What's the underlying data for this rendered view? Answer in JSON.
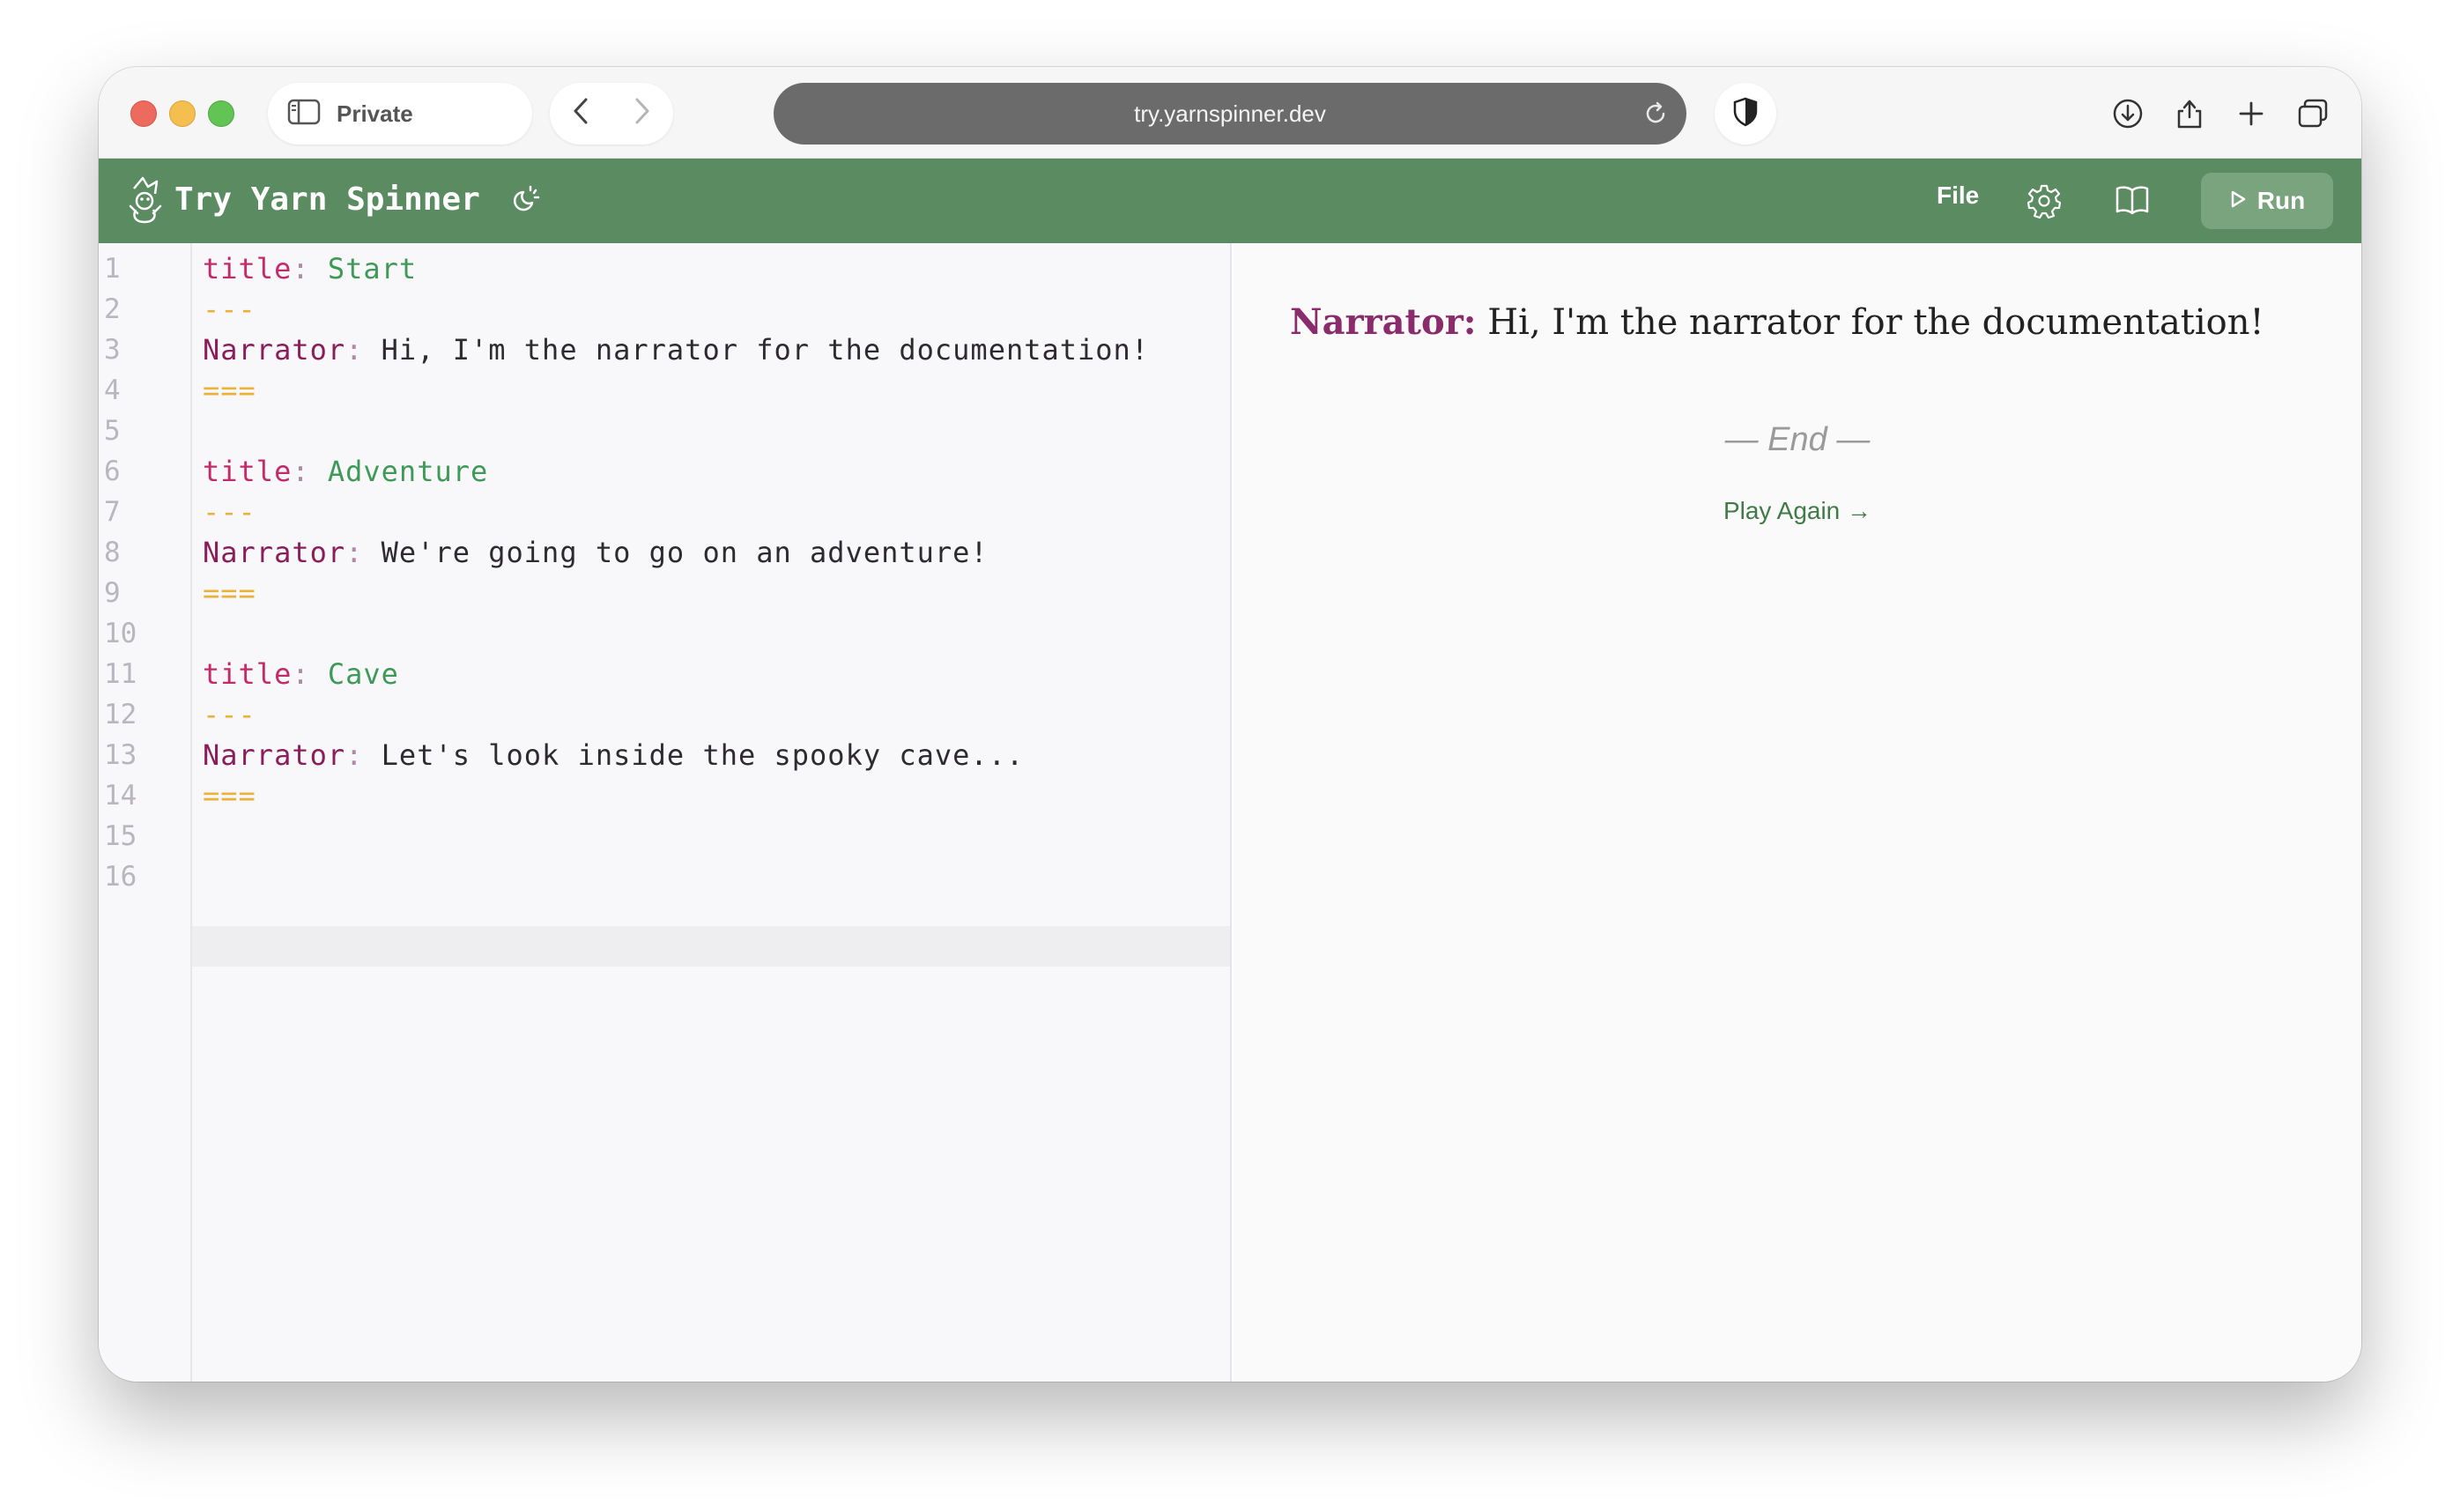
{
  "browser": {
    "private_label": "Private",
    "url": "try.yarnspinner.dev",
    "icons": [
      "sidebar-icon",
      "back-icon",
      "forward-icon",
      "reload-icon",
      "shield-icon",
      "download-icon",
      "share-icon",
      "new-tab-icon",
      "tabs-overview-icon"
    ]
  },
  "app": {
    "title": "Try Yarn Spinner",
    "file_label": "File",
    "run_label": "Run",
    "accent_color": "#5b8b61"
  },
  "editor": {
    "line_numbers": [
      "1",
      "2",
      "3",
      "4",
      "5",
      "6",
      "7",
      "8",
      "9",
      "10",
      "11",
      "12",
      "13",
      "14",
      "15",
      "16"
    ],
    "lines": [
      {
        "key": "title",
        "colon": ":",
        "value": " Start"
      },
      {
        "dash": "---"
      },
      {
        "char": "Narrator",
        "colon": ":",
        "text": " Hi, I'm the narrator for the documentation!"
      },
      {
        "dash": "==="
      },
      {},
      {
        "key": "title",
        "colon": ":",
        "value": " Adventure"
      },
      {
        "dash": "---"
      },
      {
        "char": "Narrator",
        "colon": ":",
        "text": " We're going to go on an adventure!"
      },
      {
        "dash": "==="
      },
      {},
      {
        "key": "title",
        "colon": ":",
        "value": " Cave"
      },
      {
        "dash": "---"
      },
      {
        "char": "Narrator",
        "colon": ":",
        "text": " Let's look inside the spooky cave..."
      },
      {
        "dash": "==="
      },
      {},
      {}
    ]
  },
  "preview": {
    "speaker": "Narrator:",
    "line": " Hi, I'm the narrator for the documentation!",
    "end_text": "— End —",
    "play_again": "Play Again →"
  }
}
